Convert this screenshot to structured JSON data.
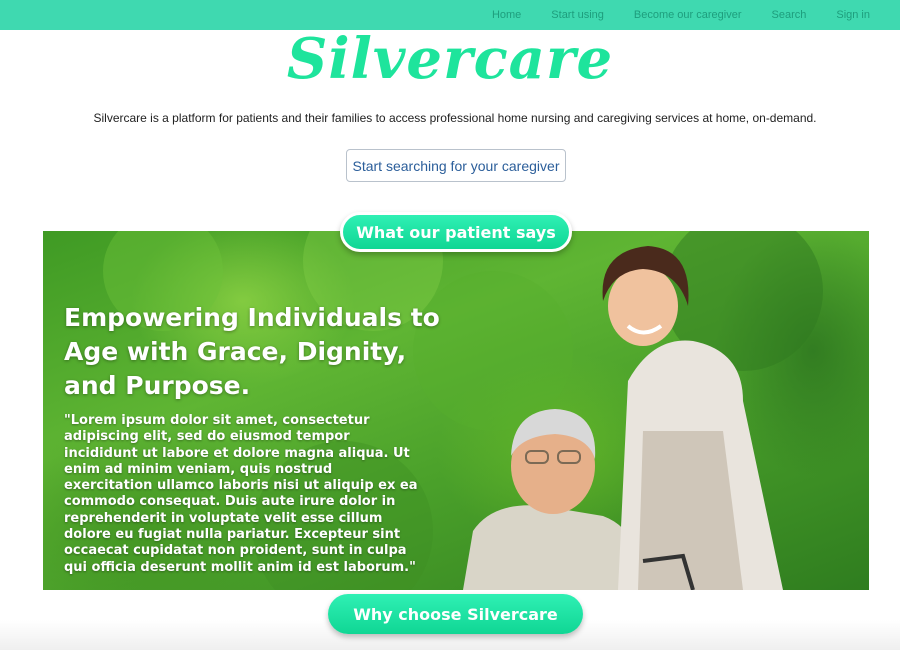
{
  "nav": {
    "items": [
      {
        "label": "Home"
      },
      {
        "label": "Start using"
      },
      {
        "label": "Become our caregiver"
      },
      {
        "label": "Search"
      },
      {
        "label": "Sign in"
      }
    ]
  },
  "brand": {
    "logo_text": "Silvercare",
    "tagline": "Silvercare is a platform for patients and their families to access professional home nursing and caregiving services at home, on-demand."
  },
  "cta": {
    "search_label": "Start searching for your caregiver"
  },
  "testimonial": {
    "section_label": "What our patient says",
    "title": "Empowering Individuals to Age with Grace, Dignity, and Purpose.",
    "quote": "\"Lorem ipsum dolor sit amet, consectetur adipiscing elit, sed do eiusmod tempor incididunt ut labore et dolore magna aliqua. Ut enim ad minim veniam, quis nostrud exercitation ullamco laboris nisi ut aliquip ex ea commodo consequat. Duis aute irure dolor in reprehenderit in voluptate velit esse cillum dolore eu fugiat nulla pariatur. Excepteur sint occaecat cupidatat non proident, sunt in culpa qui officia deserunt mollit anim id est laborum.\""
  },
  "why": {
    "label": "Why choose Silvercare"
  },
  "colors": {
    "nav_bg": "#3fd9b0",
    "brand_green": "#1ee49c",
    "link_blue": "#2b5e9a"
  }
}
